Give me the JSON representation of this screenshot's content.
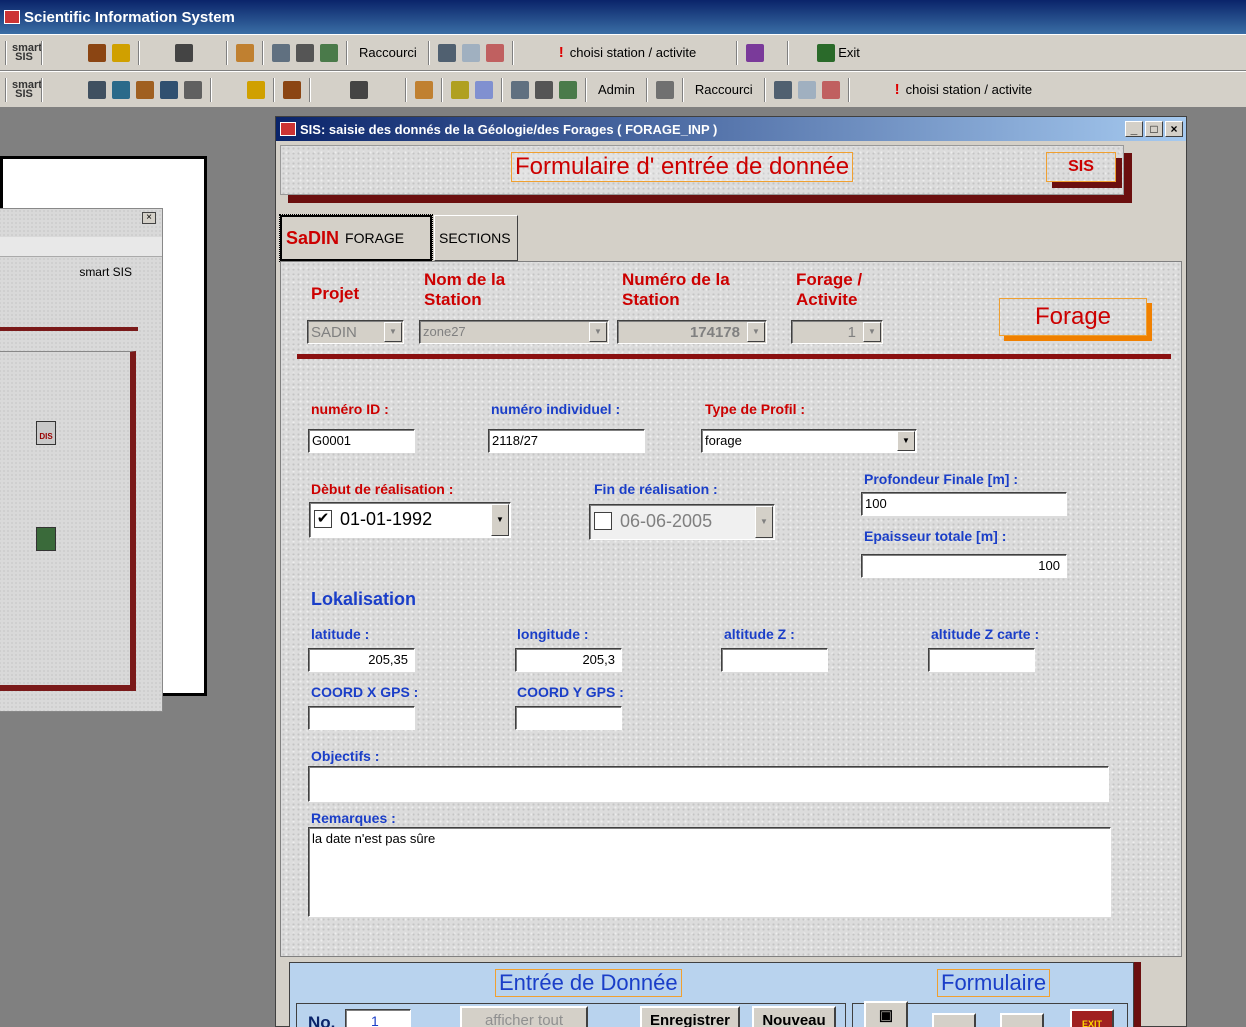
{
  "app": {
    "title": "Scientific Information System"
  },
  "toolbar1": {
    "raccourci": "Raccourci",
    "station": "choisi station / activite",
    "exit": "Exit"
  },
  "toolbar2": {
    "admin": "Admin",
    "raccourci": "Raccourci",
    "station": "choisi station / activite"
  },
  "bg_window": {
    "smart": "smart SIS",
    "close": "×"
  },
  "form_window": {
    "title": "SIS: saisie des donnés de la Géologie/des Forages ( FORAGE_INP )",
    "header_title": "Formulaire d' entrée de donnée",
    "sis_box": "SIS",
    "tabs": {
      "logo": "SaDIN",
      "forage": "FORAGE",
      "sections": "SECTIONS"
    },
    "forage_box": "Forage",
    "projet": {
      "label": "Projet",
      "value": "SADIN"
    },
    "nom_station": {
      "label": "Nom de la Station",
      "value": "zone27"
    },
    "num_station": {
      "label": "Numéro de la Station",
      "value": "174178"
    },
    "forage_activite": {
      "label": "Forage / Activite",
      "value": "1"
    },
    "numero_id": {
      "label": "numéro ID :",
      "value": "G0001"
    },
    "numero_individuel": {
      "label": "numéro individuel :",
      "value": "2118/27"
    },
    "type_profil": {
      "label": "Type de Profil :",
      "value": "forage"
    },
    "debut": {
      "label": "Dèbut de réalisation :",
      "value": "01-01-1992",
      "checked": "✔"
    },
    "fin": {
      "label": "Fin de réalisation :",
      "value": "06-06-2005"
    },
    "profondeur": {
      "label": "Profondeur Finale [m] :",
      "value": "100"
    },
    "epaisseur": {
      "label": "Epaisseur totale [m] :",
      "value": "100"
    },
    "lokalisation": "Lokalisation",
    "latitude": {
      "label": "latitude :",
      "value": "205,35"
    },
    "longitude": {
      "label": "longitude :",
      "value": "205,3"
    },
    "altitude_z": {
      "label": "altitude Z :",
      "value": ""
    },
    "altitude_z_carte": {
      "label": "altitude Z carte :",
      "value": ""
    },
    "coord_x": {
      "label": "COORD X GPS :",
      "value": ""
    },
    "coord_y": {
      "label": "COORD Y GPS :",
      "value": ""
    },
    "objectifs": {
      "label": "Objectifs :",
      "value": ""
    },
    "remarques": {
      "label": "Remarques :",
      "value": "la date n'est pas sûre"
    }
  },
  "bottom": {
    "entree": "Entrée de Donnée",
    "formulaire": "Formulaire",
    "no_label": "No.",
    "no_value": "1",
    "afficher": "afficher tout",
    "enregistrer": "Enregistrer",
    "nouveau": "Nouveau",
    "exit": "EXIT"
  }
}
